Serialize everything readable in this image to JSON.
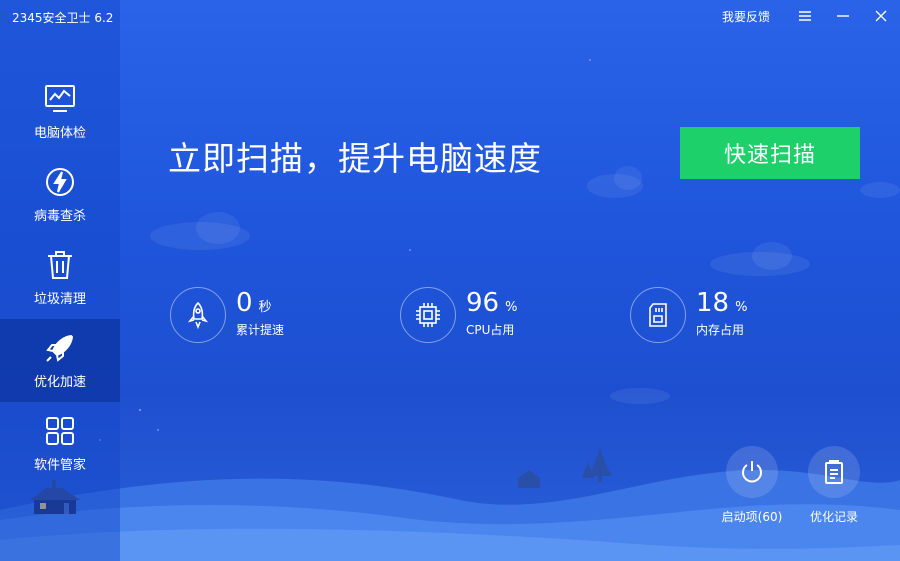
{
  "app": {
    "title": "2345安全卫士 6.2"
  },
  "topbar": {
    "feedback": "我要反馈"
  },
  "sidebar": {
    "items": [
      {
        "label": "电脑体检",
        "icon": "monitor-icon"
      },
      {
        "label": "病毒查杀",
        "icon": "lightning-shield-icon"
      },
      {
        "label": "垃圾清理",
        "icon": "trash-icon"
      },
      {
        "label": "优化加速",
        "icon": "rocket-icon",
        "active": true
      },
      {
        "label": "软件管家",
        "icon": "apps-grid-icon"
      }
    ]
  },
  "main": {
    "headline": "立即扫描，提升电脑速度",
    "scan_button": "快速扫描",
    "stats": [
      {
        "value": "0",
        "unit": "秒",
        "label": "累计提速",
        "icon": "rocket-outline-icon"
      },
      {
        "value": "96",
        "unit": "%",
        "label": "CPU占用",
        "icon": "cpu-chip-icon"
      },
      {
        "value": "18",
        "unit": "%",
        "label": "内存占用",
        "icon": "memory-card-icon"
      }
    ],
    "bottom_buttons": [
      {
        "label": "启动项(60)",
        "icon": "power-icon"
      },
      {
        "label": "优化记录",
        "icon": "clipboard-icon"
      }
    ]
  },
  "colors": {
    "accent_green": "#1ed06a",
    "background_blue": "#2a63e8"
  }
}
